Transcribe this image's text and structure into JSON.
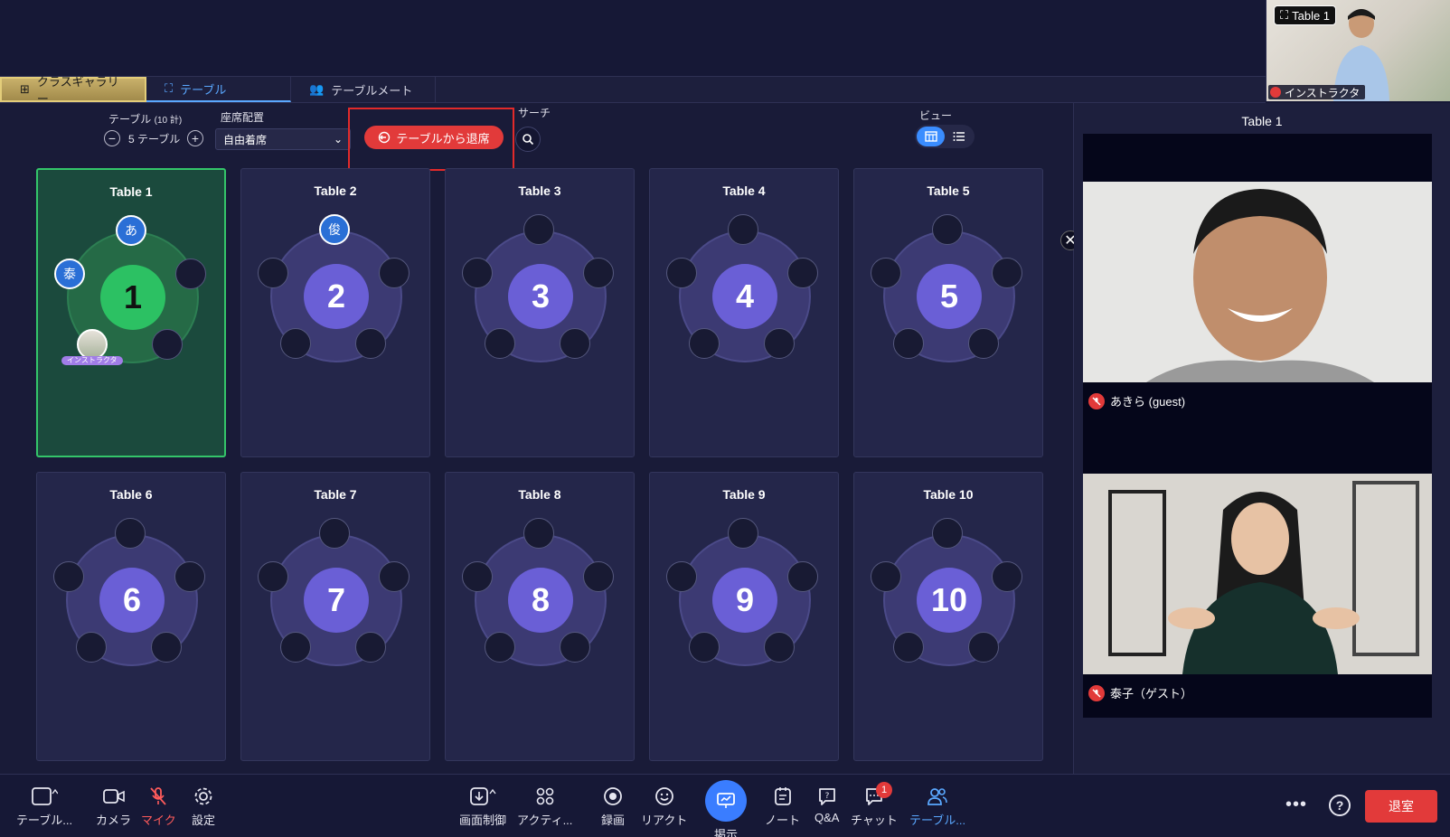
{
  "self_view": {
    "tag": "Table 1",
    "name": "インストラクタ"
  },
  "tabs": [
    {
      "label": "クラスギャラリー"
    },
    {
      "label": "テーブル"
    },
    {
      "label": "テーブルメート"
    }
  ],
  "controls": {
    "table_label": "テーブル",
    "table_total": "(10 計)",
    "table_count": "5 テーブル",
    "seating_label": "座席配置",
    "seating_value": "自由着席",
    "leave_table": "テーブルから退席",
    "search_label": "サーチ",
    "view_label": "ビュー"
  },
  "tables": [
    {
      "title": "Table 1",
      "number": "1"
    },
    {
      "title": "Table 2",
      "number": "2"
    },
    {
      "title": "Table 3",
      "number": "3"
    },
    {
      "title": "Table 4",
      "number": "4"
    },
    {
      "title": "Table 5",
      "number": "5"
    },
    {
      "title": "Table 6",
      "number": "6"
    },
    {
      "title": "Table 7",
      "number": "7"
    },
    {
      "title": "Table 8",
      "number": "8"
    },
    {
      "title": "Table 9",
      "number": "9"
    },
    {
      "title": "Table 10",
      "number": "10"
    }
  ],
  "seat_avatars": {
    "t1_top": "あ",
    "t1_left": "泰",
    "t1_instructor": "インストラクタ",
    "t2_top": "俊"
  },
  "right_panel": {
    "title": "Table 1",
    "participants": [
      {
        "name": "あきら (guest)"
      },
      {
        "name": "泰子（ゲスト）"
      }
    ]
  },
  "toolbar": {
    "table": "テーブル...",
    "camera": "カメラ",
    "mic": "マイク",
    "settings": "設定",
    "screen_control": "画面制御",
    "activity": "アクティ...",
    "record": "録画",
    "reaction": "リアクト",
    "present": "掲示",
    "note": "ノート",
    "qa": "Q&A",
    "chat": "チャット",
    "chat_badge": "1",
    "tablemates": "テーブル...",
    "more": "•••",
    "help": "?",
    "leave_room": "退室"
  },
  "colors": {
    "accent": "#3a8dff",
    "danger": "#e23a3a",
    "active_table": "#2cc163",
    "table_hub": "#6a5fd6"
  }
}
